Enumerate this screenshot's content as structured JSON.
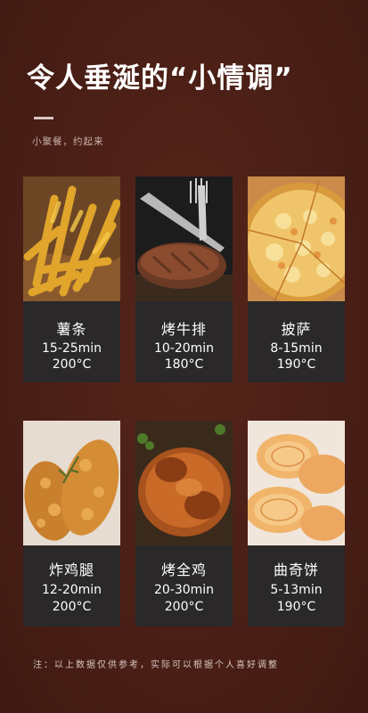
{
  "header": {
    "title": "令人垂涎的“小情调”",
    "subtitle": "小聚餐，约起来"
  },
  "dishes": [
    {
      "name": "薯条",
      "time": "15-25min",
      "temp": "200°C"
    },
    {
      "name": "烤牛排",
      "time": "10-20min",
      "temp": "180°C"
    },
    {
      "name": "披萨",
      "time": "8-15min",
      "temp": "190°C"
    },
    {
      "name": "炸鸡腿",
      "time": "12-20min",
      "temp": "200°C"
    },
    {
      "name": "烤全鸡",
      "time": "20-30min",
      "temp": "200°C"
    },
    {
      "name": "曲奇饼",
      "time": "5-13min",
      "temp": "190°C"
    }
  ],
  "footer": {
    "note": "注：以上数据仅供参考，实际可以根据个人喜好调整"
  },
  "colors": {
    "background": "#4a1f16",
    "card": "#2a2828",
    "text": "#ffffff"
  }
}
